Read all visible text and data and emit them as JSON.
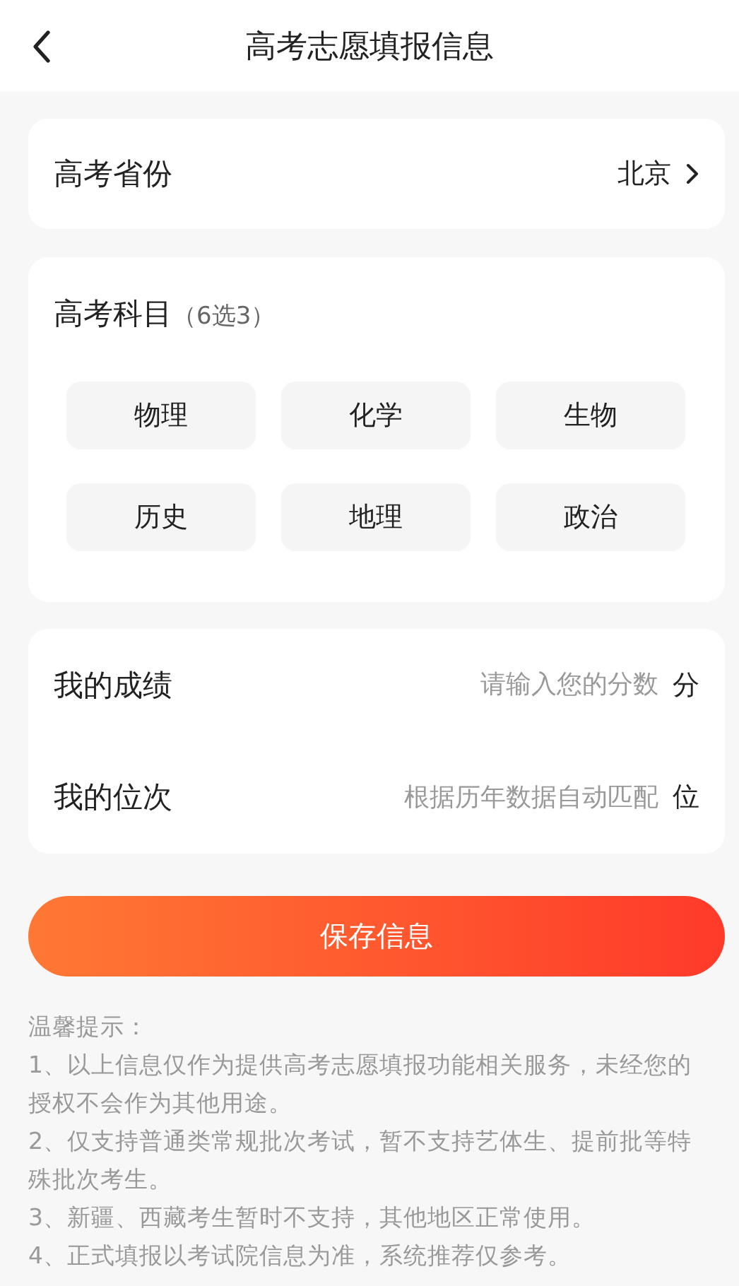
{
  "header": {
    "title": "高考志愿填报信息"
  },
  "province": {
    "label": "高考省份",
    "value": "北京"
  },
  "subjects": {
    "title": "高考科目",
    "hint": "（6选3）",
    "items": [
      {
        "label": "物理",
        "selected": false
      },
      {
        "label": "化学",
        "selected": false
      },
      {
        "label": "生物",
        "selected": false
      },
      {
        "label": "历史",
        "selected": false
      },
      {
        "label": "地理",
        "selected": false
      },
      {
        "label": "政治",
        "selected": false
      }
    ]
  },
  "fields": [
    {
      "label": "我的成绩",
      "placeholder": "请输入您的分数",
      "unit": "分"
    },
    {
      "label": "我的位次",
      "placeholder": "根据历年数据自动匹配",
      "unit": "位"
    }
  ],
  "save_button": "保存信息",
  "tips": {
    "title": "温馨提示：",
    "lines": [
      "1、以上信息仅作为提供高考志愿填报功能相关服务，未经您的授权不会作为其他用途。",
      "2、仅支持普通类常规批次考试，暂不支持艺体生、提前批等特殊批次考生。",
      "3、新疆、西藏考生暂时不支持，其他地区正常使用。",
      "4、正式填报以考试院信息为准，系统推荐仅参考。"
    ]
  }
}
